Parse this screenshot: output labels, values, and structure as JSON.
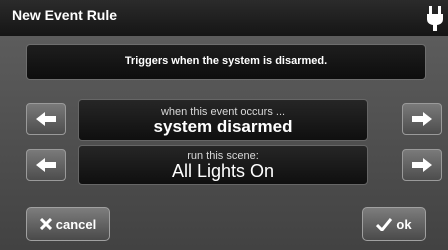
{
  "titlebar": {
    "title": "New Event Rule",
    "icon": "power-plug-icon"
  },
  "description": "Triggers when the system is disarmed.",
  "event": {
    "prompt": "when this event occurs ...",
    "value": "system disarmed",
    "prev_icon": "arrow-left-icon",
    "next_icon": "arrow-right-icon"
  },
  "scene": {
    "prompt": "run this scene:",
    "value": "All Lights On",
    "prev_icon": "arrow-left-icon",
    "next_icon": "arrow-right-icon"
  },
  "buttons": {
    "cancel_label": "cancel",
    "cancel_icon": "x-icon",
    "ok_label": "ok",
    "ok_icon": "checkmark-icon"
  }
}
